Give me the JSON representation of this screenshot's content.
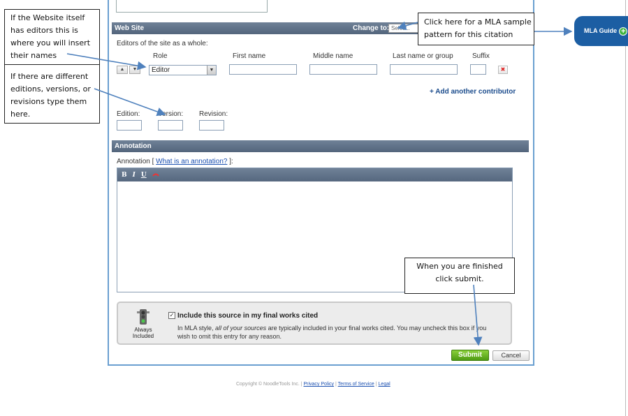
{
  "web_site": {
    "section_title": "Web Site",
    "change_to_label": "Change to:",
    "change_to_value": "Select..",
    "editors_label": "Editors of the site as a whole:",
    "columns": {
      "role": "Role",
      "first": "First name",
      "middle": "Middle name",
      "last": "Last name or group",
      "suffix": "Suffix"
    },
    "role_value": "Editor",
    "add_contributor": "+ Add another contributor",
    "edition_label": "Edition:",
    "version_label": "Version:",
    "revision_label": "Revision:"
  },
  "annotation": {
    "section_title": "Annotation",
    "label_prefix": "Annotation [",
    "link": "What is an annotation?",
    "label_suffix": "]:",
    "toolbar": {
      "bold": "B",
      "italic": "I",
      "underline": "U"
    }
  },
  "include": {
    "icon_label_1": "Always",
    "icon_label_2": "Included",
    "checkbox_label": "Include this source in my final works cited",
    "desc_1": "In MLA style,",
    "desc_em": "all of your sources",
    "desc_2": "are typically included in your final works cited. You may uncheck this box if you",
    "desc_3": "wish to omit this entry for any reason."
  },
  "buttons": {
    "submit": "Submit",
    "cancel": "Cancel"
  },
  "footer": {
    "copyright": "Copyright © NoodleTools Inc. |",
    "privacy": "Privacy Policy",
    "terms": "Terms of Service",
    "legal": "Legal",
    "sep": "|"
  },
  "mla_guide": {
    "label": "MLA Guide",
    "plus": "+"
  },
  "callouts": {
    "editors": [
      "If the Website itself",
      "has editors this is",
      "where you will insert",
      "their names"
    ],
    "editions": [
      "If there are different",
      "editions, versions, or",
      "revisions type them",
      "here."
    ],
    "mla": [
      "Click here for a MLA sample",
      "pattern for this citation"
    ],
    "submit": [
      "When you are finished",
      "click submit."
    ]
  },
  "colors": {
    "bar": "#5e7087",
    "accent": "#1c5ea3",
    "submit": "#5fae1e",
    "border": "#6a9fd0"
  }
}
